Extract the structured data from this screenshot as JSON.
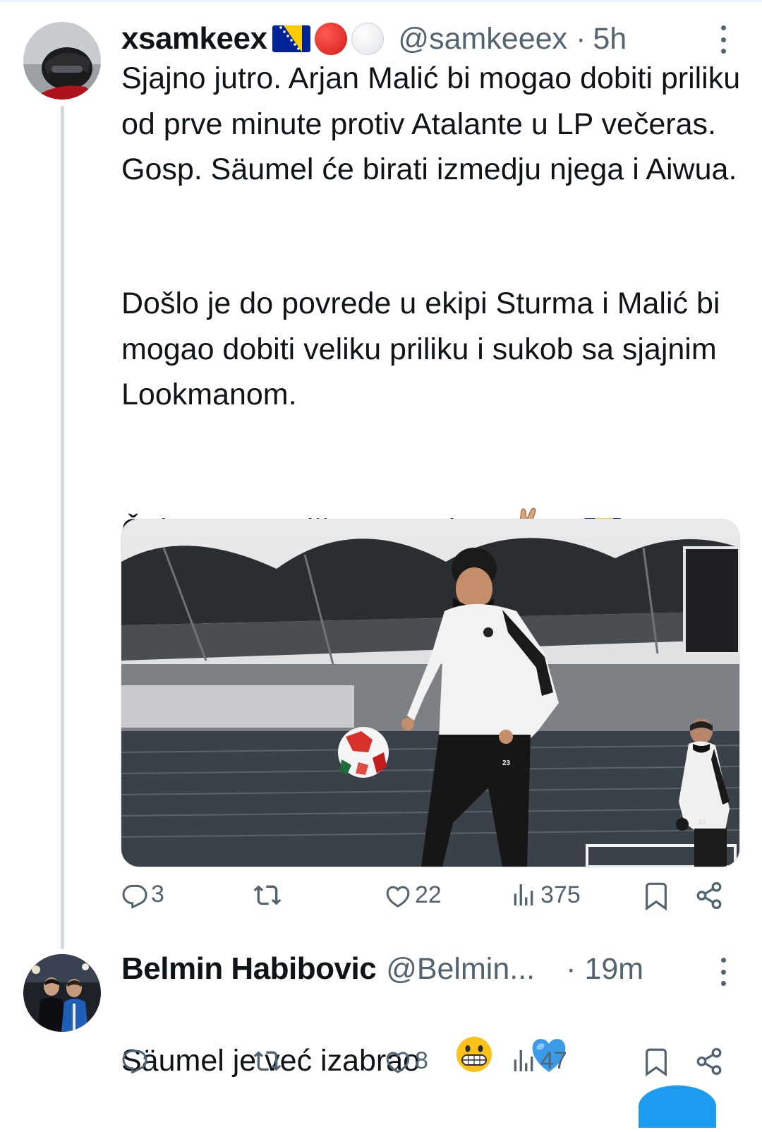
{
  "tweet": {
    "display_name": "xsamkeex",
    "name_emoji": [
      "bosnia-flag",
      "red-circle",
      "white-circle"
    ],
    "handle": "@samkeeex",
    "separator": "·",
    "time": "5h",
    "paragraphs": [
      "Sjajno jutro. Arjan Malić bi mogao dobiti priliku od prve minute protiv Atalante u LP večeras. Gosp. Säumel će birati izmedju njega i Aiwua.",
      "Došlo je do povrede u ekipi Sturma i Malić bi mogao dobiti veliku priliku i sukob sa sjajnim Lookmanom.",
      "Čekamo zvaničnu potvrdu"
    ],
    "closing_emoji": [
      "crossed-fingers",
      "bosnia-flag"
    ],
    "media_lettering": [
      "23",
      "23"
    ],
    "stats": {
      "replies": "3",
      "retweets": "",
      "likes": "22",
      "views": "375"
    }
  },
  "reply": {
    "display_name": "Belmin Habibovic",
    "handle": "@Belmin...",
    "separator": "·",
    "time": "19m",
    "text": "Säumel je već izabrao",
    "text_emoji": [
      "grinning-face",
      "blue-heart"
    ],
    "stats": {
      "replies": "",
      "retweets": "",
      "likes": "8",
      "views": "47"
    }
  },
  "colors": {
    "text": "#0f1419",
    "muted": "#536471",
    "thread_line": "#cfd9de",
    "blue_heart": "#3b9be8",
    "bosnia_blue": "#002395",
    "bosnia_yellow": "#fecb00"
  },
  "icons": [
    "reply-icon",
    "retweet-icon",
    "like-icon",
    "views-icon",
    "bookmark-icon",
    "share-icon",
    "more-icon"
  ]
}
